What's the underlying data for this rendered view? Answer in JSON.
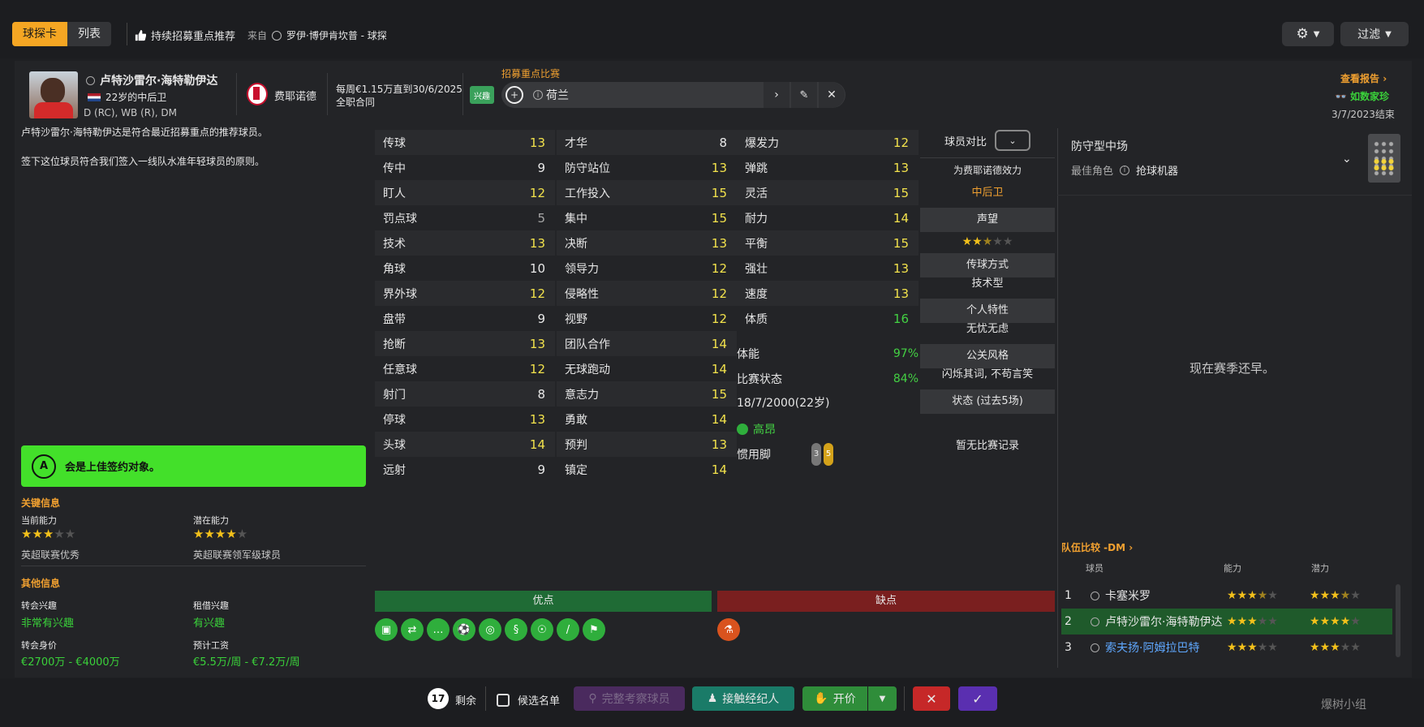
{
  "top": {
    "tab_scout_card": "球探卡",
    "tab_list": "列表",
    "keep_recommend": "持续招募重点推荐",
    "from_label": "来自",
    "from_person": "罗伊·博伊肯坎普 - 球探",
    "settings_icon": "gear-icon",
    "filter_label": "过滤"
  },
  "player": {
    "name": "卢特沙雷尔·海特勒伊达",
    "age_role": "22岁的中后卫",
    "positions": "D (RC), WB (R), DM",
    "club": "费耶诺德",
    "contract_line1": "每周€1.15万直到30/6/2025",
    "contract_line2": "全职合同",
    "interest_badge": "兴趣",
    "focus_match_label": "招募重点比赛",
    "focus_match_value": "荷兰",
    "view_report": "查看报告",
    "rarity": "如数家珍",
    "report_date": "3/7/2023结束"
  },
  "summary": {
    "line1": "卢特沙雷尔·海特勒伊达是符合最近招募重点的推荐球员。",
    "line2": "签下这位球员符合我们签入一线队水准年轻球员的原则。"
  },
  "grade": {
    "letter": "A",
    "text": "会是上佳签约对象。",
    "color": "#43e02a"
  },
  "key_info": {
    "title": "关键信息",
    "ca_label": "当前能力",
    "ca_stars": 3,
    "ca_desc": "英超联赛优秀",
    "pa_label": "潜在能力",
    "pa_stars": 4,
    "pa_desc": "英超联赛领军级球员"
  },
  "other_info": {
    "title": "其他信息",
    "transfer_interest_label": "转会兴趣",
    "transfer_interest_value": "非常有兴趣",
    "loan_interest_label": "租借兴趣",
    "loan_interest_value": "有兴趣",
    "value_label": "转会身价",
    "value_value": "€2700万 - €4000万",
    "wage_label": "预计工资",
    "wage_value": "€5.5万/周 - €7.2万/周"
  },
  "technical": [
    {
      "name": "传球",
      "value": "13",
      "tone": "yellow"
    },
    {
      "name": "传中",
      "value": "9",
      "tone": "white"
    },
    {
      "name": "盯人",
      "value": "12",
      "tone": "yellow"
    },
    {
      "name": "罚点球",
      "value": "5",
      "tone": "grey"
    },
    {
      "name": "技术",
      "value": "13",
      "tone": "yellow"
    },
    {
      "name": "角球",
      "value": "10",
      "tone": "white"
    },
    {
      "name": "界外球",
      "value": "12",
      "tone": "yellow"
    },
    {
      "name": "盘带",
      "value": "9",
      "tone": "white"
    },
    {
      "name": "抢断",
      "value": "13",
      "tone": "yellow"
    },
    {
      "name": "任意球",
      "value": "12",
      "tone": "yellow"
    },
    {
      "name": "射门",
      "value": "8",
      "tone": "white"
    },
    {
      "name": "停球",
      "value": "13",
      "tone": "yellow"
    },
    {
      "name": "头球",
      "value": "14",
      "tone": "yellow"
    },
    {
      "name": "远射",
      "value": "9",
      "tone": "white"
    }
  ],
  "mental": [
    {
      "name": "才华",
      "value": "8",
      "tone": "white"
    },
    {
      "name": "防守站位",
      "value": "13",
      "tone": "yellow"
    },
    {
      "name": "工作投入",
      "value": "15",
      "tone": "yellow"
    },
    {
      "name": "集中",
      "value": "15",
      "tone": "yellow"
    },
    {
      "name": "决断",
      "value": "13",
      "tone": "yellow"
    },
    {
      "name": "领导力",
      "value": "12",
      "tone": "yellow"
    },
    {
      "name": "侵略性",
      "value": "12",
      "tone": "yellow"
    },
    {
      "name": "视野",
      "value": "12",
      "tone": "yellow"
    },
    {
      "name": "团队合作",
      "value": "14",
      "tone": "yellow"
    },
    {
      "name": "无球跑动",
      "value": "14",
      "tone": "yellow"
    },
    {
      "name": "意志力",
      "value": "15",
      "tone": "yellow"
    },
    {
      "name": "勇敢",
      "value": "14",
      "tone": "yellow"
    },
    {
      "name": "预判",
      "value": "13",
      "tone": "yellow"
    },
    {
      "name": "镇定",
      "value": "14",
      "tone": "yellow"
    }
  ],
  "physical": [
    {
      "name": "爆发力",
      "value": "12",
      "tone": "yellow"
    },
    {
      "name": "弹跳",
      "value": "13",
      "tone": "yellow"
    },
    {
      "name": "灵活",
      "value": "15",
      "tone": "yellow"
    },
    {
      "name": "耐力",
      "value": "14",
      "tone": "yellow"
    },
    {
      "name": "平衡",
      "value": "15",
      "tone": "yellow"
    },
    {
      "name": "强壮",
      "value": "13",
      "tone": "yellow"
    },
    {
      "name": "速度",
      "value": "13",
      "tone": "yellow"
    },
    {
      "name": "体质",
      "value": "16",
      "tone": "green"
    }
  ],
  "condition": {
    "fitness_label": "体能",
    "fitness_value": "97%",
    "form_label": "比赛状态",
    "form_value": "84%",
    "dob": "18/7/2000(22岁)",
    "morale": "高昂",
    "foot_label": "惯用脚",
    "left_foot": "3",
    "right_foot": "5"
  },
  "compare": {
    "title": "球员对比",
    "effort_title": "为费耶诺德效力",
    "effort_value": "中后卫",
    "reputation": "声望",
    "rep_stars": 2.5,
    "passing_style": "传球方式",
    "passing_value": "技术型",
    "personality": "个人特性",
    "personality_value": "无忧无虑",
    "media": "公关风格",
    "media_value": "闪烁其词, 不苟言笑",
    "form": "状态 (过去5场)",
    "no_record": "暂无比赛记录"
  },
  "role": {
    "position": "防守型中场",
    "best_role_label": "最佳角色",
    "best_role": "抢球机器",
    "empty_msg": "现在赛季还早。"
  },
  "squad": {
    "title": "队伍比较 -DM",
    "col_player": "球员",
    "col_ability": "能力",
    "col_potential": "潜力",
    "rows": [
      {
        "rank": "1",
        "name": "卡塞米罗",
        "ability": 3.5,
        "potential": 3.5
      },
      {
        "rank": "2",
        "name": "卢特沙雷尔·海特勒伊达",
        "ability": 3,
        "potential": 4
      },
      {
        "rank": "3",
        "name": "索夫扬·阿姆拉巴特",
        "ability": 3,
        "potential": 3
      }
    ]
  },
  "pros_cons": {
    "pros": "优点",
    "cons": "缺点"
  },
  "bottom": {
    "remaining_count": "17",
    "remaining_label": "剩余",
    "shortlist": "候选名单",
    "full_scout": "完整考察球员",
    "contact_agent": "接触经纪人",
    "make_offer": "开价"
  },
  "watermark": "爆树小组"
}
